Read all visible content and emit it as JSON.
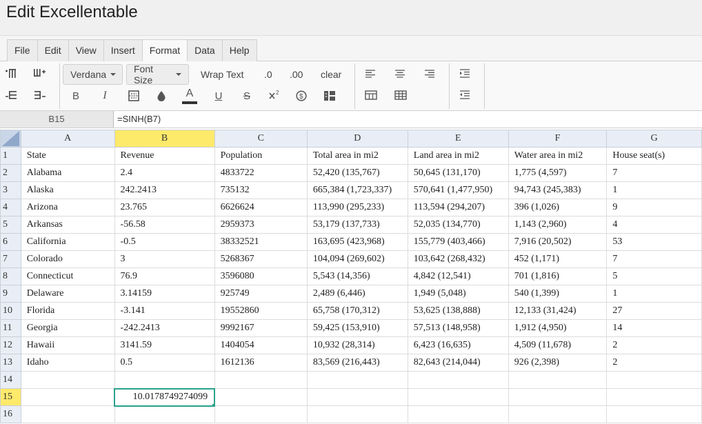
{
  "app": {
    "title": "Edit Excellentable"
  },
  "menu": {
    "tabs": [
      {
        "label": "File"
      },
      {
        "label": "Edit"
      },
      {
        "label": "View"
      },
      {
        "label": "Insert"
      },
      {
        "label": "Format",
        "active": true
      },
      {
        "label": "Data"
      },
      {
        "label": "Help"
      }
    ]
  },
  "toolbar": {
    "font_family": "Verdana",
    "font_size": "Font Size",
    "wrap_text": "Wrap Text",
    "decrease_decimal": ".0",
    "increase_decimal": ".00",
    "clear": "clear",
    "bold": "B",
    "italic": "I",
    "text_color": "A",
    "underline": "U",
    "strikethrough": "S"
  },
  "formula_bar": {
    "cell_ref": "B15",
    "formula": "=SINH(B7)"
  },
  "sheet": {
    "columns": [
      "A",
      "B",
      "C",
      "D",
      "E",
      "F",
      "G"
    ],
    "active_column": "B",
    "active_row": 15,
    "rows": [
      {
        "n": "1",
        "cells": [
          "State",
          "Revenue",
          "Population",
          "Total area in mi2",
          "Land area in mi2",
          "Water area in mi2",
          "House seat(s)"
        ]
      },
      {
        "n": "2",
        "cells": [
          "Alabama",
          "2.4",
          "4833722",
          "52,420 (135,767)",
          "50,645 (131,170)",
          "1,775 (4,597)",
          "7"
        ]
      },
      {
        "n": "3",
        "cells": [
          "Alaska",
          "242.2413",
          "735132",
          "665,384 (1,723,337)",
          "570,641 (1,477,950)",
          "94,743 (245,383)",
          "1"
        ]
      },
      {
        "n": "4",
        "cells": [
          "Arizona",
          "23.765",
          "6626624",
          "113,990 (295,233)",
          "113,594 (294,207)",
          "396 (1,026)",
          "9"
        ]
      },
      {
        "n": "5",
        "cells": [
          "Arkansas",
          "-56.58",
          "2959373",
          "53,179 (137,733)",
          "52,035 (134,770)",
          "1,143 (2,960)",
          "4"
        ]
      },
      {
        "n": "6",
        "cells": [
          "California",
          "-0.5",
          "38332521",
          "163,695 (423,968)",
          "155,779 (403,466)",
          "7,916 (20,502)",
          "53"
        ]
      },
      {
        "n": "7",
        "cells": [
          "Colorado",
          "3",
          "5268367",
          "104,094 (269,602)",
          "103,642 (268,432)",
          "452 (1,171)",
          "7"
        ]
      },
      {
        "n": "8",
        "cells": [
          "Connecticut",
          "76.9",
          "3596080",
          "5,543 (14,356)",
          "4,842 (12,541)",
          "701 (1,816)",
          "5"
        ]
      },
      {
        "n": "9",
        "cells": [
          "Delaware",
          "3.14159",
          "925749",
          "2,489 (6,446)",
          "1,949 (5,048)",
          "540 (1,399)",
          "1"
        ]
      },
      {
        "n": "10",
        "cells": [
          "Florida",
          "-3.141",
          "19552860",
          "65,758 (170,312)",
          "53,625 (138,888)",
          "12,133 (31,424)",
          "27"
        ]
      },
      {
        "n": "11",
        "cells": [
          "Georgia",
          "-242.2413",
          "9992167",
          "59,425 (153,910)",
          "57,513 (148,958)",
          "1,912 (4,950)",
          "14"
        ]
      },
      {
        "n": "12",
        "cells": [
          "Hawaii",
          "3141.59",
          "1404054",
          "10,932 (28,314)",
          "6,423 (16,635)",
          "4,509 (11,678)",
          "2"
        ]
      },
      {
        "n": "13",
        "cells": [
          "Idaho",
          "0.5",
          "1612136",
          "83,569 (216,443)",
          "82,643 (214,044)",
          "926 (2,398)",
          "2"
        ]
      },
      {
        "n": "14",
        "cells": [
          "",
          "",
          "",
          "",
          "",
          "",
          ""
        ]
      },
      {
        "n": "15",
        "cells": [
          "",
          "10.0178749274099",
          "",
          "",
          "",
          "",
          ""
        ]
      },
      {
        "n": "16",
        "cells": [
          "",
          "",
          "",
          "",
          "",
          "",
          ""
        ]
      }
    ]
  }
}
